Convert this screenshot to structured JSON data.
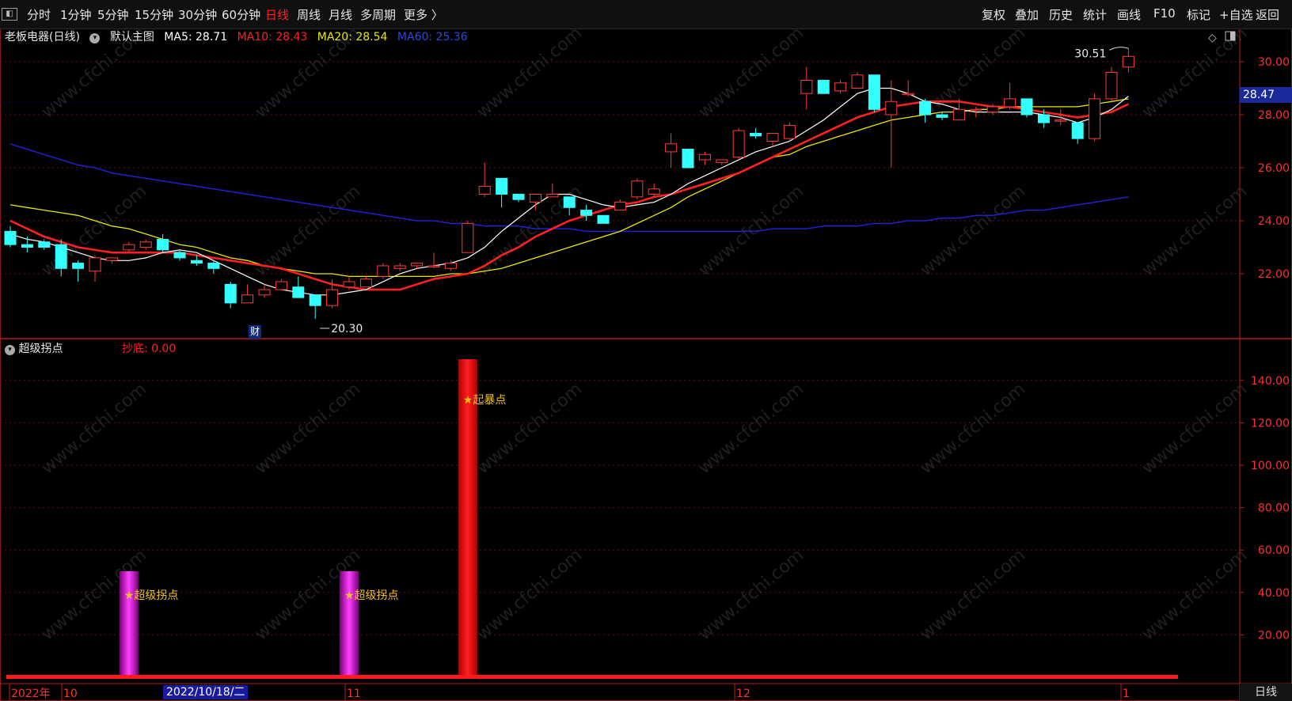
{
  "toolbar": {
    "panel_icon": "◧",
    "left_items": [
      "分时",
      "1分钟",
      "5分钟",
      "15分钟",
      "30分钟",
      "60分钟",
      "日线",
      "周线",
      "月线",
      "多周期",
      "更多 〉"
    ],
    "active_item": "日线",
    "right_items": [
      "复权",
      "叠加",
      "历史",
      "统计",
      "画线",
      "F10",
      "标记",
      "+自选",
      "返回"
    ]
  },
  "main_panel": {
    "stock": "老板电器(日线)",
    "template": "默认主图",
    "ma5_label": "MA5: 28.71",
    "ma10_label": "MA10: 28.43",
    "ma20_label": "MA20: 28.54",
    "ma60_label": "MA60: 25.36",
    "high_annotation": "30.51",
    "low_annotation": "20.30",
    "current_price": "28.47",
    "cai_marker": "财",
    "yticks": [
      "30.00",
      "28.00",
      "26.00",
      "24.00",
      "22.00"
    ]
  },
  "sub_panel": {
    "indicator": "超级拐点",
    "status_label": "抄底: 0.00",
    "yticks": [
      "140.00",
      "120.00",
      "100.00",
      "80.00",
      "60.00",
      "40.00",
      "20.00"
    ],
    "signals": [
      {
        "label": "★超级拐点",
        "value": 50,
        "color": "magenta"
      },
      {
        "label": "★超级拐点",
        "value": 50,
        "color": "magenta"
      },
      {
        "label": "★起暴点",
        "value": 150,
        "color": "red"
      }
    ]
  },
  "x_axis": {
    "labels": [
      "2022年",
      "10",
      "11",
      "12",
      "1"
    ],
    "cursor_date": "2022/10/18/二",
    "period_label": "日线"
  },
  "watermark": "www.cfchi.com",
  "colors": {
    "up": "#ff3b3b",
    "down": "#33ffff",
    "ma5": "#ffffff",
    "ma10": "#ff2020",
    "ma20": "#e8e800",
    "ma60": "#2020d0",
    "accent_red": "#ff2020",
    "magenta": "#e000e0"
  },
  "chart_data": {
    "type": "candlestick",
    "ylim": [
      20,
      31
    ],
    "candles": [
      {
        "o": 23.6,
        "h": 23.8,
        "l": 23.0,
        "c": 23.1
      },
      {
        "o": 23.1,
        "h": 23.4,
        "l": 22.8,
        "c": 23.0
      },
      {
        "o": 23.2,
        "h": 23.3,
        "l": 22.9,
        "c": 23.0
      },
      {
        "o": 23.1,
        "h": 23.3,
        "l": 21.9,
        "c": 22.2
      },
      {
        "o": 22.4,
        "h": 22.5,
        "l": 21.7,
        "c": 22.2
      },
      {
        "o": 22.1,
        "h": 22.7,
        "l": 21.7,
        "c": 22.6
      },
      {
        "o": 22.5,
        "h": 22.6,
        "l": 22.4,
        "c": 22.6
      },
      {
        "o": 22.9,
        "h": 23.2,
        "l": 22.8,
        "c": 23.1
      },
      {
        "o": 23.0,
        "h": 23.3,
        "l": 22.9,
        "c": 23.2
      },
      {
        "o": 23.3,
        "h": 23.5,
        "l": 22.8,
        "c": 22.9
      },
      {
        "o": 22.8,
        "h": 22.9,
        "l": 22.5,
        "c": 22.6
      },
      {
        "o": 22.5,
        "h": 22.7,
        "l": 22.3,
        "c": 22.4
      },
      {
        "o": 22.4,
        "h": 22.5,
        "l": 22.0,
        "c": 22.2
      },
      {
        "o": 21.6,
        "h": 21.7,
        "l": 20.7,
        "c": 20.9
      },
      {
        "o": 20.9,
        "h": 21.6,
        "l": 20.9,
        "c": 21.2
      },
      {
        "o": 21.2,
        "h": 21.6,
        "l": 21.1,
        "c": 21.4
      },
      {
        "o": 21.4,
        "h": 21.8,
        "l": 21.4,
        "c": 21.7
      },
      {
        "o": 21.5,
        "h": 21.9,
        "l": 21.1,
        "c": 21.1
      },
      {
        "o": 21.2,
        "h": 21.2,
        "l": 20.3,
        "c": 20.8
      },
      {
        "o": 20.8,
        "h": 21.8,
        "l": 20.7,
        "c": 21.4
      },
      {
        "o": 21.5,
        "h": 21.9,
        "l": 21.4,
        "c": 21.7
      },
      {
        "o": 21.5,
        "h": 21.9,
        "l": 21.5,
        "c": 21.8
      },
      {
        "o": 21.9,
        "h": 22.4,
        "l": 21.8,
        "c": 22.3
      },
      {
        "o": 22.2,
        "h": 22.4,
        "l": 22.1,
        "c": 22.3
      },
      {
        "o": 22.3,
        "h": 22.4,
        "l": 22.2,
        "c": 22.4
      },
      {
        "o": 22.3,
        "h": 22.8,
        "l": 22.2,
        "c": 22.3
      },
      {
        "o": 22.2,
        "h": 22.5,
        "l": 22.1,
        "c": 22.4
      },
      {
        "o": 22.8,
        "h": 24.0,
        "l": 22.8,
        "c": 23.9
      },
      {
        "o": 25.0,
        "h": 26.2,
        "l": 24.9,
        "c": 25.3
      },
      {
        "o": 25.6,
        "h": 25.6,
        "l": 24.5,
        "c": 25.0
      },
      {
        "o": 25.0,
        "h": 25.0,
        "l": 24.7,
        "c": 24.8
      },
      {
        "o": 24.7,
        "h": 25.0,
        "l": 24.4,
        "c": 25.0
      },
      {
        "o": 24.9,
        "h": 25.4,
        "l": 24.9,
        "c": 25.0
      },
      {
        "o": 24.9,
        "h": 24.9,
        "l": 24.2,
        "c": 24.5
      },
      {
        "o": 24.4,
        "h": 24.6,
        "l": 24.0,
        "c": 24.2
      },
      {
        "o": 24.2,
        "h": 24.2,
        "l": 23.9,
        "c": 23.9
      },
      {
        "o": 24.4,
        "h": 24.8,
        "l": 24.4,
        "c": 24.7
      },
      {
        "o": 24.9,
        "h": 25.6,
        "l": 24.8,
        "c": 25.5
      },
      {
        "o": 25.0,
        "h": 25.4,
        "l": 24.9,
        "c": 25.2
      },
      {
        "o": 26.6,
        "h": 27.3,
        "l": 26.0,
        "c": 26.9
      },
      {
        "o": 26.7,
        "h": 26.7,
        "l": 26.0,
        "c": 26.0
      },
      {
        "o": 26.3,
        "h": 26.6,
        "l": 26.1,
        "c": 26.5
      },
      {
        "o": 26.2,
        "h": 26.3,
        "l": 26.1,
        "c": 26.3
      },
      {
        "o": 26.4,
        "h": 27.5,
        "l": 26.3,
        "c": 27.4
      },
      {
        "o": 27.3,
        "h": 27.5,
        "l": 27.1,
        "c": 27.2
      },
      {
        "o": 27.0,
        "h": 27.3,
        "l": 26.8,
        "c": 27.3
      },
      {
        "o": 27.1,
        "h": 27.7,
        "l": 27.0,
        "c": 27.6
      },
      {
        "o": 28.8,
        "h": 29.8,
        "l": 28.2,
        "c": 29.3
      },
      {
        "o": 29.3,
        "h": 29.3,
        "l": 28.8,
        "c": 28.8
      },
      {
        "o": 28.9,
        "h": 29.3,
        "l": 28.8,
        "c": 29.2
      },
      {
        "o": 29.0,
        "h": 29.6,
        "l": 29.0,
        "c": 29.5
      },
      {
        "o": 29.5,
        "h": 29.5,
        "l": 28.1,
        "c": 28.2
      },
      {
        "o": 28.0,
        "h": 29.3,
        "l": 26.0,
        "c": 28.5
      },
      {
        "o": 28.8,
        "h": 29.3,
        "l": 28.7,
        "c": 28.8
      },
      {
        "o": 28.5,
        "h": 28.6,
        "l": 27.7,
        "c": 28.0
      },
      {
        "o": 28.0,
        "h": 28.1,
        "l": 27.8,
        "c": 27.9
      },
      {
        "o": 27.8,
        "h": 28.6,
        "l": 27.8,
        "c": 28.2
      },
      {
        "o": 28.2,
        "h": 28.3,
        "l": 27.9,
        "c": 28.2
      },
      {
        "o": 28.1,
        "h": 28.4,
        "l": 28.0,
        "c": 28.3
      },
      {
        "o": 28.3,
        "h": 29.2,
        "l": 28.2,
        "c": 28.6
      },
      {
        "o": 28.6,
        "h": 28.6,
        "l": 27.9,
        "c": 28.0
      },
      {
        "o": 28.0,
        "h": 28.2,
        "l": 27.5,
        "c": 27.7
      },
      {
        "o": 27.8,
        "h": 28.2,
        "l": 27.6,
        "c": 27.8
      },
      {
        "o": 27.7,
        "h": 27.7,
        "l": 26.9,
        "c": 27.1
      },
      {
        "o": 27.1,
        "h": 28.8,
        "l": 27.0,
        "c": 28.6
      },
      {
        "o": 28.6,
        "h": 29.8,
        "l": 28.5,
        "c": 29.6
      },
      {
        "o": 29.8,
        "h": 30.5,
        "l": 29.6,
        "c": 30.2
      }
    ],
    "ma5": [
      23.5,
      23.3,
      23.2,
      23.0,
      22.8,
      22.6,
      22.5,
      22.5,
      22.6,
      22.8,
      22.9,
      22.8,
      22.5,
      22.2,
      21.9,
      21.6,
      21.4,
      21.3,
      21.2,
      21.2,
      21.3,
      21.4,
      21.7,
      22.0,
      22.2,
      22.3,
      22.4,
      22.6,
      23.0,
      23.6,
      24.1,
      24.6,
      25.0,
      25.0,
      24.8,
      24.6,
      24.5,
      24.6,
      24.7,
      25.0,
      25.4,
      25.7,
      26.0,
      26.3,
      26.6,
      26.8,
      27.0,
      27.4,
      27.8,
      28.3,
      28.8,
      29.0,
      29.0,
      28.8,
      28.5,
      28.4,
      28.2,
      28.1,
      28.1,
      28.1,
      28.1,
      28.0,
      27.9,
      27.7,
      27.9,
      28.2,
      28.7
    ],
    "ma10": [
      24.0,
      23.7,
      23.4,
      23.2,
      23.0,
      22.9,
      22.8,
      22.8,
      22.8,
      22.8,
      22.8,
      22.7,
      22.6,
      22.5,
      22.4,
      22.3,
      22.2,
      22.0,
      21.8,
      21.6,
      21.5,
      21.4,
      21.4,
      21.4,
      21.6,
      21.8,
      21.9,
      22.0,
      22.3,
      22.7,
      23.0,
      23.4,
      23.7,
      24.0,
      24.2,
      24.4,
      24.6,
      24.7,
      24.9,
      25.0,
      25.2,
      25.4,
      25.6,
      25.8,
      26.1,
      26.4,
      26.7,
      27.0,
      27.3,
      27.6,
      27.9,
      28.1,
      28.3,
      28.4,
      28.5,
      28.5,
      28.5,
      28.4,
      28.3,
      28.3,
      28.2,
      28.1,
      28.0,
      27.9,
      28.0,
      28.1,
      28.4
    ],
    "ma20": [
      24.6,
      24.5,
      24.4,
      24.3,
      24.2,
      24.0,
      23.8,
      23.7,
      23.5,
      23.3,
      23.1,
      23.0,
      22.8,
      22.6,
      22.5,
      22.3,
      22.2,
      22.1,
      22.0,
      22.0,
      21.9,
      21.9,
      21.9,
      21.9,
      21.9,
      21.9,
      22.0,
      22.0,
      22.1,
      22.2,
      22.4,
      22.6,
      22.8,
      23.0,
      23.2,
      23.4,
      23.6,
      23.9,
      24.2,
      24.5,
      24.9,
      25.2,
      25.5,
      25.8,
      26.1,
      26.4,
      26.5,
      26.8,
      27.0,
      27.2,
      27.4,
      27.6,
      27.8,
      27.9,
      28.0,
      28.1,
      28.1,
      28.2,
      28.2,
      28.3,
      28.3,
      28.3,
      28.3,
      28.3,
      28.4,
      28.5,
      28.6
    ],
    "ma60": [
      26.9,
      26.7,
      26.5,
      26.3,
      26.1,
      26.0,
      25.8,
      25.7,
      25.6,
      25.5,
      25.4,
      25.3,
      25.2,
      25.1,
      25.0,
      24.9,
      24.8,
      24.7,
      24.6,
      24.5,
      24.4,
      24.3,
      24.2,
      24.1,
      24.0,
      24.0,
      23.9,
      23.9,
      23.8,
      23.8,
      23.8,
      23.7,
      23.7,
      23.7,
      23.6,
      23.6,
      23.6,
      23.6,
      23.6,
      23.6,
      23.6,
      23.6,
      23.6,
      23.6,
      23.6,
      23.7,
      23.7,
      23.7,
      23.8,
      23.8,
      23.8,
      23.9,
      23.9,
      24.0,
      24.0,
      24.1,
      24.1,
      24.2,
      24.2,
      24.3,
      24.4,
      24.4,
      24.5,
      24.6,
      24.7,
      24.8,
      24.9
    ]
  }
}
